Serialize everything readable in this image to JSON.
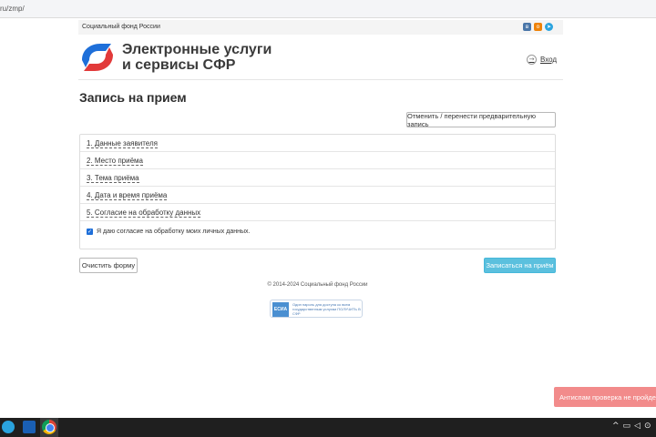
{
  "browser": {
    "url_fragment": "ru/zmp/"
  },
  "topbar": {
    "org_name": "Социальный фонд России",
    "social": [
      "vk-icon",
      "ok-icon",
      "telegram-icon"
    ]
  },
  "header": {
    "brand_line1": "Электронные услуги",
    "brand_line2": "и сервисы СФР",
    "login_label": "Вход"
  },
  "page": {
    "title": "Запись на прием",
    "cancel_prev_label": "Отменить / перенести предварительную запись"
  },
  "steps": [
    {
      "label": "1. Данные заявителя"
    },
    {
      "label": "2. Место приёма"
    },
    {
      "label": "3. Тема приёма"
    },
    {
      "label": "4. Дата и время приёма"
    },
    {
      "label": "5. Согласие на обработку данных"
    }
  ],
  "consent": {
    "checked": true,
    "text": "Я даю согласие на обработку моих личных данных."
  },
  "actions": {
    "clear_label": "Очистить форму",
    "submit_label": "Записаться на приём"
  },
  "footer": {
    "copyright": "© 2014-2024 Социальный фонд России"
  },
  "esia": {
    "badge": "ЕСИА",
    "text": "Один пароль для доступа ко всем государственным услугам ПОЛУЧИТЬ В СФР"
  },
  "toast": {
    "text": "Антиспам проверка не пройдена"
  },
  "colors": {
    "accent": "#5bc0de",
    "toast": "#f28b8b",
    "brand_blue": "#1e6fd9",
    "brand_red": "#e23a3a"
  }
}
